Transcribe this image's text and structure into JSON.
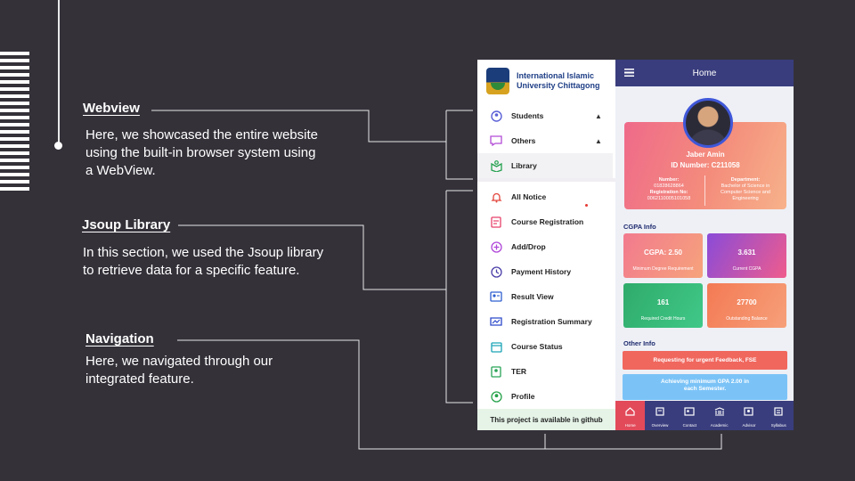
{
  "sections": {
    "webview": {
      "title": "Webview",
      "lines": [
        "Here, we showcased the entire website",
        "using the built-in browser system using",
        "a WebView."
      ]
    },
    "jsoup": {
      "title": "Jsoup Library",
      "lines": [
        "In this section, we used the Jsoup library",
        "to retrieve data for a specific feature."
      ]
    },
    "navigation": {
      "title": "Navigation",
      "lines": [
        "Here, we navigated through our",
        "integrated feature."
      ]
    }
  },
  "drawer": {
    "university_lines": [
      "International Islamic",
      "University Chittagong"
    ],
    "items": [
      {
        "label": "Students",
        "icon": "students-icon",
        "expand": "chevron-up"
      },
      {
        "label": "Others",
        "icon": "others-icon",
        "expand": "chevron-up"
      },
      {
        "label": "Library",
        "icon": "library-icon",
        "selected": true
      },
      {
        "label": "All Notice",
        "icon": "notice-icon"
      },
      {
        "label": "Course Registration",
        "icon": "course-registration-icon"
      },
      {
        "label": "Add/Drop",
        "icon": "add-drop-icon"
      },
      {
        "label": "Payment History",
        "icon": "payment-history-icon"
      },
      {
        "label": "Result View",
        "icon": "result-view-icon"
      },
      {
        "label": "Registration Summary",
        "icon": "registration-summary-icon"
      },
      {
        "label": "Course Status",
        "icon": "course-status-icon"
      },
      {
        "label": "TER",
        "icon": "ter-icon"
      },
      {
        "label": "Profile",
        "icon": "profile-icon"
      }
    ],
    "footer": "This project is available in github"
  },
  "app": {
    "title": "Home",
    "student": {
      "name": "Jaber Amin",
      "id_line": "ID Number: C211058",
      "number_label": "Number:",
      "number_value": "01828628864",
      "reg_label": "Registration No:",
      "reg_value": "0062110005101058",
      "dept_label": "Department:",
      "dept_value": [
        "Bachelor of Science in",
        "Computer Science and",
        "Engineering"
      ]
    },
    "cgpa_title": "CGPA Info",
    "tiles": [
      {
        "value": "CGPA: 2.50",
        "label": "Minimum Degree Requirement",
        "gradient": [
          "#f27a8e",
          "#f6a37c"
        ]
      },
      {
        "value": "3.631",
        "label": "Current CGPA",
        "gradient": [
          "#8a4bd8",
          "#ef5c8d"
        ]
      },
      {
        "value": "161",
        "label": "Required Credit Hours",
        "gradient": [
          "#2fab6a",
          "#40c888"
        ]
      },
      {
        "value": "27700",
        "label": "Outstanding Balance",
        "gradient": [
          "#f37a54",
          "#f6a07a"
        ]
      }
    ],
    "other_title": "Other Info",
    "notices": [
      {
        "text": "Requesting for urgent Feedback, FSE",
        "color": "#f0675e"
      },
      {
        "text": "Achieving minimum GPA 2.00 in each Semester.",
        "color": "#7bc3f7"
      }
    ],
    "nav": [
      {
        "label": "Home",
        "icon": "home-icon",
        "active": true
      },
      {
        "label": "Overview",
        "icon": "overview-icon"
      },
      {
        "label": "Contact",
        "icon": "contact-icon"
      },
      {
        "label": "Academic",
        "icon": "academic-icon"
      },
      {
        "label": "Advisor",
        "icon": "advisor-icon"
      },
      {
        "label": "Syllabus",
        "icon": "syllabus-icon"
      }
    ]
  }
}
